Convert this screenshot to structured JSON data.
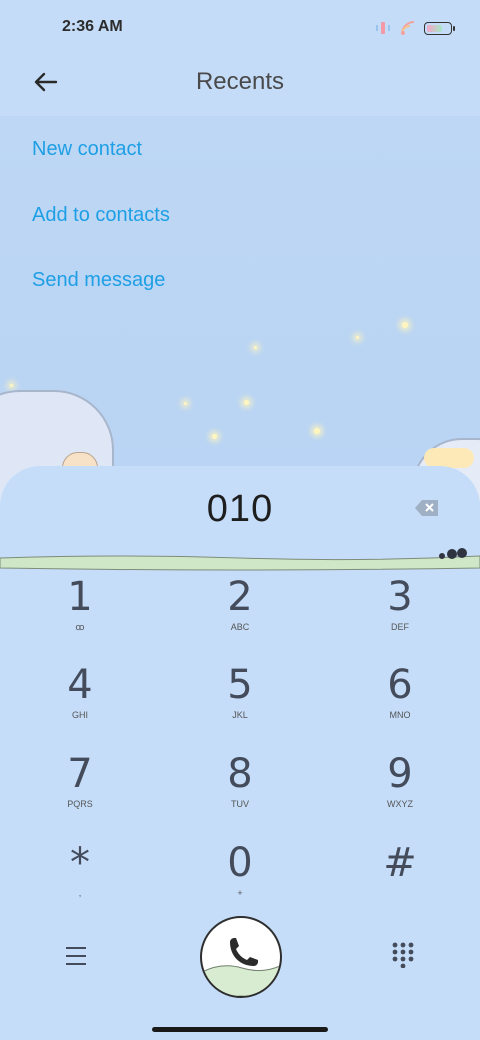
{
  "status": {
    "time": "2:36 AM",
    "icons": [
      "vibrate-icon",
      "wifi-icon",
      "battery-icon"
    ]
  },
  "header": {
    "title": "Recents",
    "back_icon": "back-arrow-icon"
  },
  "actions": [
    {
      "label": "New contact"
    },
    {
      "label": "Add to contacts"
    },
    {
      "label": "Send message"
    }
  ],
  "dialer": {
    "number": "010",
    "keys": [
      {
        "digit": "1",
        "letters": "ꝏ"
      },
      {
        "digit": "2",
        "letters": "ABC"
      },
      {
        "digit": "3",
        "letters": "DEF"
      },
      {
        "digit": "4",
        "letters": "GHI"
      },
      {
        "digit": "5",
        "letters": "JKL"
      },
      {
        "digit": "6",
        "letters": "MNO"
      },
      {
        "digit": "7",
        "letters": "PQRS"
      },
      {
        "digit": "8",
        "letters": "TUV"
      },
      {
        "digit": "9",
        "letters": "WXYZ"
      },
      {
        "digit": "*",
        "letters": ","
      },
      {
        "digit": "0",
        "letters": "+"
      },
      {
        "digit": "#",
        "letters": ""
      }
    ]
  },
  "colors": {
    "accent": "#1e9fe5",
    "background": "#c4dcf8",
    "text": "#4a4a4a"
  }
}
